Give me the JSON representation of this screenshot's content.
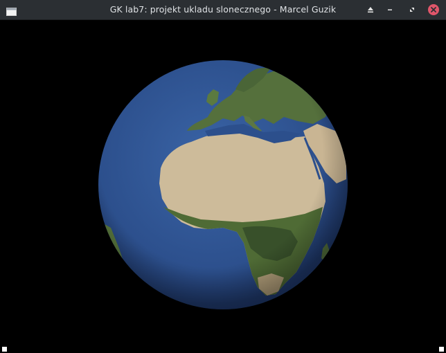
{
  "window": {
    "title": "GK lab7: projekt ukladu slonecznego - Marcel Guzik",
    "controls": [
      "keep-above-icon",
      "minimize-icon",
      "maximize-icon",
      "close-icon"
    ]
  },
  "scene": {
    "background_color": "#000000",
    "ocean_color": "#2c4f8c",
    "land_colors": {
      "desert": "#cdbb9a",
      "vegetation": "#4d6a34",
      "forest": "#3a5229"
    }
  }
}
